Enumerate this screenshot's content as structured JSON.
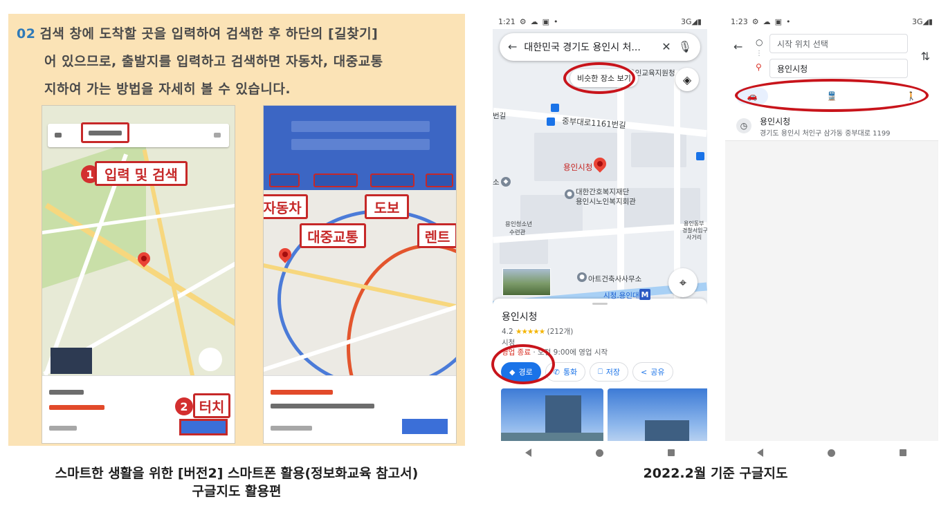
{
  "textbook": {
    "step_number": "02",
    "line1": "검색 창에 도착할 곳을 입력하여 검색한 후 하단의 [길찾기]",
    "line2": "어 있으므로, 출발지를 입력하고 검색하면 자동차, 대중교통",
    "line3": "지하여 가는 방법을 자세히 볼 수 있습니다.",
    "callout_search": "입력 및 검색",
    "callout_touch": "터치",
    "badge1": "1",
    "badge2": "2",
    "callout_car": "자동차",
    "callout_transit": "대중교통",
    "callout_walk": "도보",
    "callout_rent": "렌트"
  },
  "phone_mid": {
    "status_time": "1:21",
    "status_right": "3G◢▮",
    "search_query": "대한민국 경기도 용인시 처...",
    "similar_places": "비슷한 장소 보기",
    "map_labels": {
      "road1": "중부대로1161번길",
      "edge_left": "번길",
      "city_hall": "용인시청",
      "welfare1": "대한간호복지재단",
      "welfare2": "용인시노인복지회관",
      "edu": "용인교육지원청",
      "youth1": "용인청소년",
      "youth2": "수련관",
      "police1": "용인동부",
      "police2": "경찰서입구",
      "police3": "사거리",
      "arch": "아트건축사사무소",
      "station": "시청.용인대",
      "metro": "M",
      "edge_so": "소"
    },
    "place": {
      "name": "용인시청",
      "rating": "4.2",
      "stars": "★★★★★",
      "review_count": "(212개)",
      "category": "시청",
      "hours_status": "영업 종료",
      "hours_next": "· 오전 9:00에 영업 시작"
    },
    "actions": {
      "directions": "경로",
      "call": "통화",
      "save": "저장",
      "share": "공유"
    }
  },
  "phone_right": {
    "status_time": "1:23",
    "status_right": "3G◢▮",
    "start_placeholder": "시작 위치 선택",
    "destination": "용인시청",
    "recent_name": "용인시청",
    "recent_address": "경기도 용인시 처인구 삼가동 중부대로 1199"
  },
  "captions": {
    "left_line1": "스마트한 생활을 위한 [버전2] 스마트폰 활용(정보화교육 참고서)",
    "left_line2": "구글지도 활용편",
    "right": "2022.2월 기준 구글지도"
  },
  "colors": {
    "annotation_red": "#c8141b",
    "google_blue": "#1a73e8",
    "book_bg": "#fbe3b6"
  }
}
